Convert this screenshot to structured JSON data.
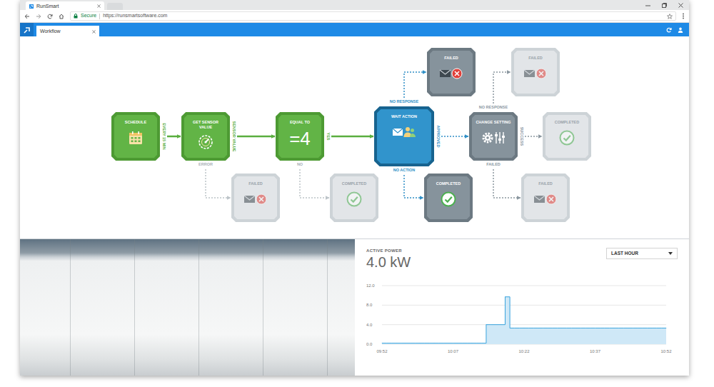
{
  "browser": {
    "tabs": [
      {
        "title": "RunSmart",
        "selected": true
      }
    ],
    "security": "Secure",
    "url": "https://runsmartsoftware.com"
  },
  "app": {
    "tabs": [
      {
        "label": "Workflow",
        "selected": true
      }
    ]
  },
  "diagram": {
    "nodes": [
      {
        "label": "SCHEDULE",
        "kind": "schedule",
        "status": "done"
      },
      {
        "label": "GET SENSOR VALUE",
        "kind": "sensor",
        "status": "done"
      },
      {
        "label": "EQUAL TO",
        "kind": "compare",
        "value": "=4",
        "status": "done"
      },
      {
        "label": "WAIT ACTION",
        "kind": "notify",
        "status": "current"
      },
      {
        "label": "CHANGE SETTING",
        "kind": "setting",
        "status": "pending"
      },
      {
        "label": "FAILED",
        "kind": "failed",
        "status": "pending"
      },
      {
        "label": "FAILED",
        "kind": "failed",
        "status": "inactive"
      },
      {
        "label": "COMPLETED",
        "kind": "completed",
        "status": "inactive"
      },
      {
        "label": "FAILED",
        "kind": "failed",
        "status": "inactive"
      },
      {
        "label": "COMPLETED",
        "kind": "completed",
        "status": "inactive"
      },
      {
        "label": "COMPLETED",
        "kind": "completed",
        "status": "pending"
      },
      {
        "label": "FAILED",
        "kind": "failed",
        "status": "inactive"
      }
    ],
    "edges": [
      {
        "from": 0,
        "to": 1,
        "label": "EVERY 15 MIN",
        "state": "done"
      },
      {
        "from": 1,
        "to": 2,
        "label": "SENSOR VALUE",
        "state": "done"
      },
      {
        "from": 1,
        "to": 8,
        "label": "ERROR",
        "state": "inactive"
      },
      {
        "from": 2,
        "to": 3,
        "label": "YES",
        "state": "done"
      },
      {
        "from": 2,
        "to": 9,
        "label": "NO",
        "state": "inactive"
      },
      {
        "from": 3,
        "to": 5,
        "label": "NO RESPONSE",
        "state": "current"
      },
      {
        "from": 3,
        "to": 4,
        "label": "APPROVED",
        "state": "current"
      },
      {
        "from": 3,
        "to": 10,
        "label": "NO ACTION",
        "state": "current"
      },
      {
        "from": 4,
        "to": 6,
        "label": "NO RESPONSE",
        "state": "pending"
      },
      {
        "from": 4,
        "to": 7,
        "label": "SUCCESS",
        "state": "pending"
      },
      {
        "from": 4,
        "to": 11,
        "label": "FAILED",
        "state": "pending"
      }
    ]
  },
  "chart": {
    "title": "ACTIVE POWER",
    "reading": "4.0 kW",
    "range": {
      "label": "LAST HOUR"
    },
    "y_ticks": [
      "12.0",
      "8.0",
      "4.0",
      "0.0"
    ],
    "x_ticks": [
      "09:52",
      "10:07",
      "10:22",
      "10:37",
      "10:52"
    ],
    "series": [
      {
        "values": [
          0.2,
          0.2,
          0.2,
          0.2,
          0.2,
          0.2,
          0.2,
          0.2,
          0.2,
          0.2,
          0.2,
          0.2,
          0.2,
          0.2,
          0.2,
          0.2,
          0.2,
          0.2,
          0.2,
          0.2,
          0.2,
          0.2,
          4.0,
          4.0,
          4.0,
          4.0,
          9.7,
          3.3,
          3.3,
          3.3,
          3.3,
          3.3,
          3.3,
          3.3,
          3.3,
          3.3,
          3.3,
          3.3,
          3.3,
          3.3,
          3.3,
          3.3,
          3.3,
          3.3,
          3.3,
          3.3,
          3.3,
          3.3,
          3.3,
          3.3,
          3.3,
          3.3,
          3.3,
          3.3,
          3.3,
          3.3,
          3.3,
          3.3,
          3.3,
          3.3,
          3.3
        ]
      }
    ]
  }
}
